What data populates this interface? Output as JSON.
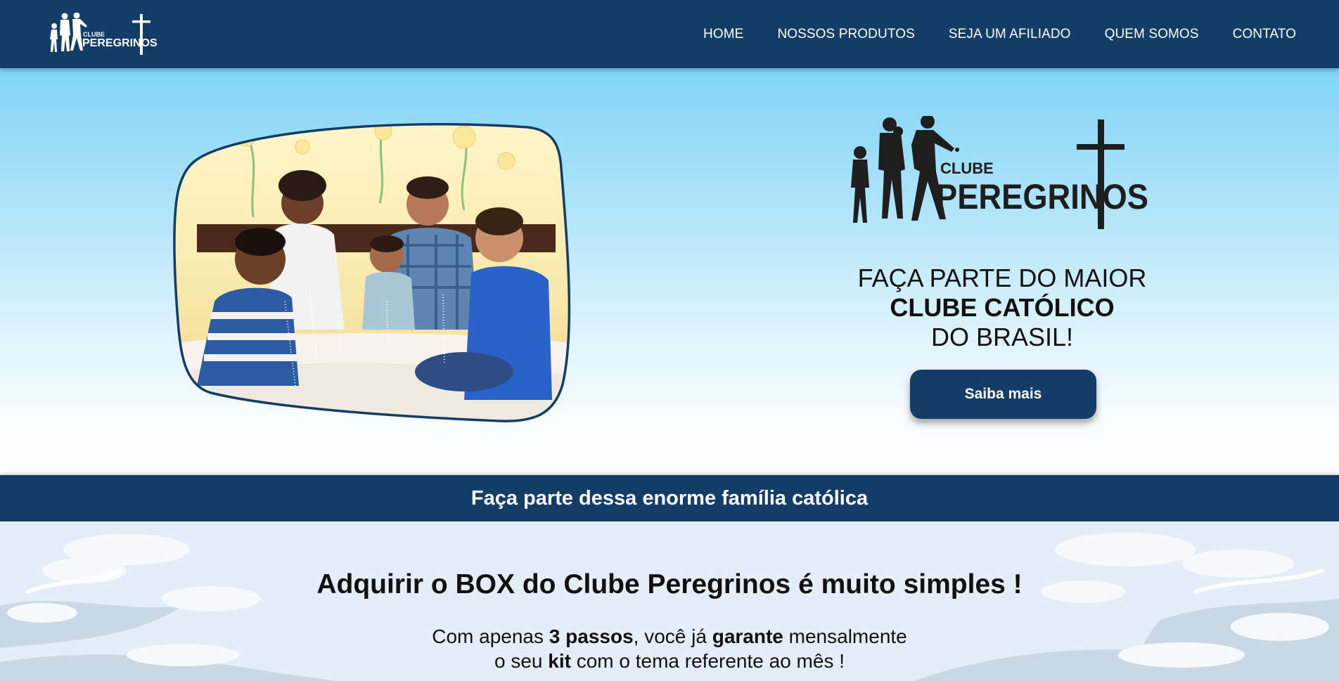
{
  "header": {
    "logo_alt": "Clube Peregrinos",
    "nav": [
      {
        "label": "HOME"
      },
      {
        "label": "NOSSOS PRODUTOS"
      },
      {
        "label": "SEJA UM AFILIADO"
      },
      {
        "label": "QUEM SOMOS"
      },
      {
        "label": "CONTATO"
      }
    ]
  },
  "logo": {
    "line1": "CLUBE",
    "line2": "PEREGRINOS"
  },
  "hero": {
    "photo_alt": "Família rezando o terço",
    "tagline_line1": "FAÇA PARTE DO MAIOR",
    "tagline_line2": "CLUBE CATÓLICO",
    "tagline_line3": "DO BRASIL!",
    "cta_label": "Saiba mais"
  },
  "banner": {
    "text": "Faça parte dessa enorme família católica"
  },
  "steps": {
    "title": "Adquirir o BOX do Clube Peregrinos é muito simples !",
    "line1_a": "Com apenas ",
    "line1_b": "3 passos",
    "line1_c": ", você já ",
    "line1_d": "garante",
    "line1_e": " mensalmente",
    "line2_a": "o seu ",
    "line2_b": "kit",
    "line2_c": " com o tema referente ao mês !"
  },
  "colors": {
    "navy": "#133c66",
    "sky": "#80d4f6",
    "white": "#ffffff"
  }
}
